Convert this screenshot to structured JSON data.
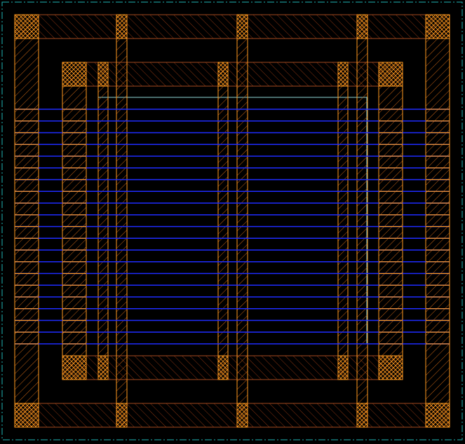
{
  "layout_viewer": {
    "background": "#000000",
    "colors": {
      "boundary": "#1fb5b5",
      "active_region": "#8fd8d8",
      "poly_outline": "#ff9a1f",
      "poly_hatch": "#c86414",
      "diffusion_outline": "#a34a1f",
      "diffusion_hatch": "#8a3412",
      "metal_line": "#1f2cff",
      "contact_crosshatch": "#ff9a1f"
    },
    "layers": {
      "metal_line_count": 21,
      "gate_finger_count": 3,
      "contact_pad_count": 8
    }
  }
}
